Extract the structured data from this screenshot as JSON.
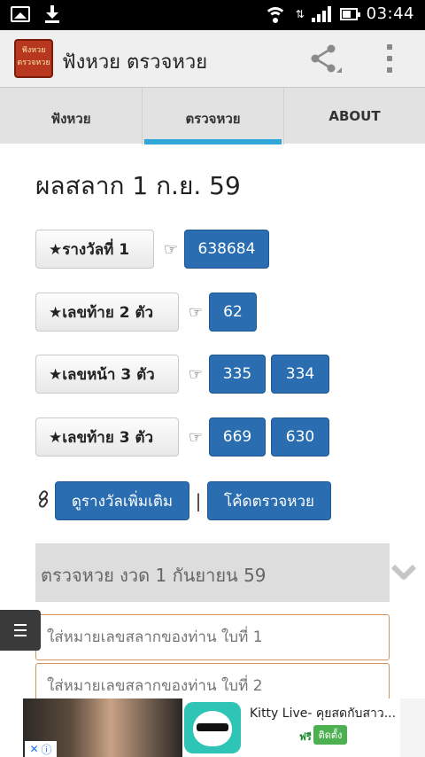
{
  "status_bar": {
    "time": "03:44"
  },
  "app_bar": {
    "logo_text_line1": "ฟังหวย",
    "logo_text_line2": "ตรวจหวย",
    "title": "ฟังหวย ตรวจหวย"
  },
  "tabs": [
    {
      "label": "ฟังหวย",
      "active": false
    },
    {
      "label": "ตรวจหวย",
      "active": true
    },
    {
      "label": "ABOUT",
      "active": false
    }
  ],
  "result_title": "ผลสลาก 1 ก.ย. 59",
  "prizes": [
    {
      "label": "★รางวัลที่ 1",
      "numbers": [
        "638684"
      ]
    },
    {
      "label": "★เลขท้าย 2 ตัว",
      "numbers": [
        "62"
      ]
    },
    {
      "label": "★เลขหน้า 3 ตัว",
      "numbers": [
        "335",
        "334"
      ]
    },
    {
      "label": "★เลขท้าย 3 ตัว",
      "numbers": [
        "669",
        "630"
      ]
    }
  ],
  "links": {
    "more_prizes": "ดูรางวัลเพิ่มเติม",
    "separator": "|",
    "check_code": "โค้ดตรวจหวย"
  },
  "check_section": {
    "header": "ตรวจหวย งวด 1 กันยายน 59",
    "input1_placeholder": "ใส่หมายเลขสลากของท่าน ใบที่ 1",
    "input2_placeholder": "ใส่หมายเลขสลากของท่าน ใบที่ 2"
  },
  "ad": {
    "title": "Kitty Live- คุยสดกับสาว...",
    "free_label": "ฟรี",
    "install_label": "ติดตั้ง"
  },
  "colors": {
    "accent_tab": "#2fa7d9",
    "primary_button": "#2a6db0",
    "input_border": "#d7935c"
  }
}
